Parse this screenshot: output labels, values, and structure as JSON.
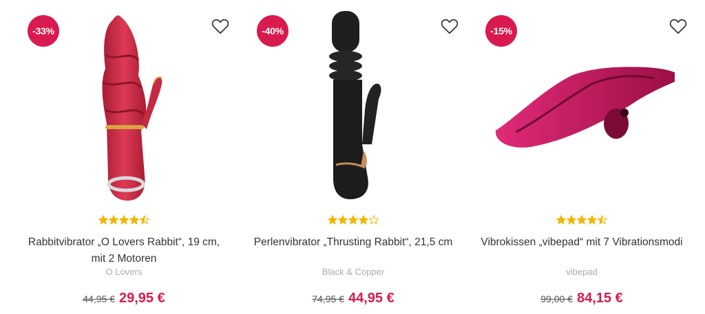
{
  "products": [
    {
      "discount": "-33%",
      "rating": 4.5,
      "title": "Rabbitvibrator „O Lovers Rabbit“, 19 cm, mit 2 Motoren",
      "brand": "O Lovers",
      "old_price": "44,95 €",
      "new_price": "29,95 €",
      "image_icon": "red-rabbit-vibrator-image",
      "color": "#c8283f"
    },
    {
      "discount": "-40%",
      "rating": 4,
      "title": "Perlenvibrator „Thrusting Rabbit“, 21,5 cm",
      "brand": "Black & Copper",
      "old_price": "74,95 €",
      "new_price": "44,95 €",
      "image_icon": "black-rabbit-vibrator-image",
      "color": "#1c1c1c"
    },
    {
      "discount": "-15%",
      "rating": 4.5,
      "title": "Vibrokissen „vibepad“ mit 7 Vibrationsmodi",
      "brand": "vibepad",
      "old_price": "99,00 €",
      "new_price": "84,15 €",
      "image_icon": "pink-vibepad-image",
      "color": "#b8124f"
    }
  ],
  "colors": {
    "accent": "#d81a4f",
    "star": "#f2b600"
  }
}
